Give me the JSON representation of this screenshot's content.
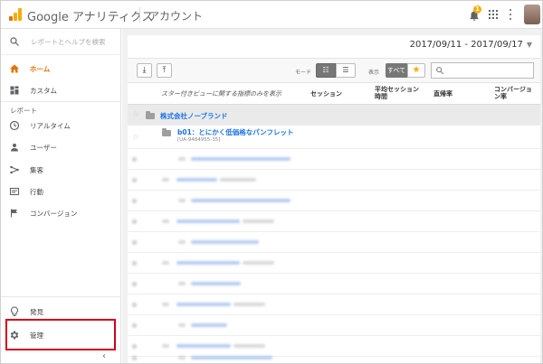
{
  "header": {
    "brand": "Google アナリティクス",
    "account": "アカウント",
    "notification_count": "1"
  },
  "sidebar": {
    "search_placeholder": "レポートとヘルプを検索",
    "items": [
      {
        "label": "ホーム",
        "icon": "home-icon"
      },
      {
        "label": "カスタム",
        "icon": "dashboard-icon"
      },
      {
        "label": "リアルタイム",
        "icon": "clock-icon"
      },
      {
        "label": "ユーザー",
        "icon": "person-icon"
      },
      {
        "label": "集客",
        "icon": "acquisition-icon"
      },
      {
        "label": "行動",
        "icon": "behavior-icon"
      },
      {
        "label": "コンバージョン",
        "icon": "flag-icon"
      }
    ],
    "report_header": "レポート",
    "bottom_items": [
      {
        "label": "発見",
        "icon": "lightbulb-icon"
      },
      {
        "label": "管理",
        "icon": "gear-icon"
      }
    ]
  },
  "content": {
    "date_range": "2017/09/11 - 2017/09/17",
    "toolbar": {
      "mode_label": "モード",
      "display_label": "表示",
      "display_all": "すべて"
    },
    "table": {
      "headers": {
        "left": "スター付きビューに関する指標のみを表示",
        "sessions": "セッション",
        "avg_session_line1": "平均セッション",
        "avg_session_line2": "時間",
        "bounce": "直帰率",
        "conversion_line1": "コンバージョ",
        "conversion_line2": "ン率"
      },
      "org_name": "株式会社ノーブランド",
      "property_name": "b01：とにかく低価格なパンフレット",
      "property_id": "[UA-9484955-35]"
    }
  },
  "colors": {
    "accent": "#e37400",
    "link": "#1a73e8",
    "highlight": "#d0021b"
  }
}
